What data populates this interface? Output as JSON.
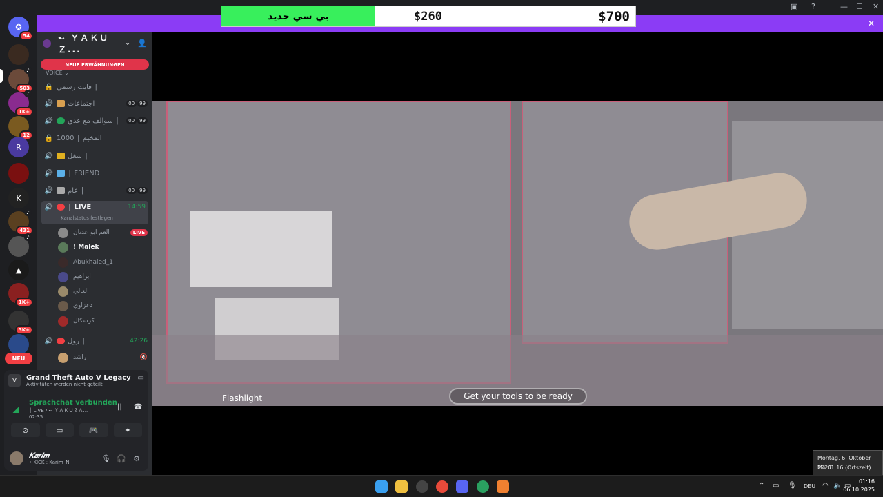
{
  "rail": {
    "badges": [
      "54",
      "503",
      "1K+",
      "12",
      "431",
      "1K+",
      "3K+"
    ],
    "neu_label": "NEU"
  },
  "sidebar": {
    "server_name": "➸ ＹＡＫＵＺ...",
    "mentions_label": "NEUE ERWÄHNUNGEN",
    "voice_category": "VOICE",
    "channels": [
      {
        "name": "فايت رسمي │",
        "count_a": "",
        "count_b": ""
      },
      {
        "name": "اجتماعات │",
        "count_a": "00",
        "count_b": "99"
      },
      {
        "name": "سوالف مع عدي │",
        "count_a": "00",
        "count_b": "99"
      },
      {
        "name": "المخيم │ 1000",
        "count_a": "",
        "count_b": ""
      },
      {
        "name": "شغل │",
        "count_a": "",
        "count_b": ""
      },
      {
        "name": "│ FRIEND",
        "count_a": "",
        "count_b": ""
      },
      {
        "name": "عام │",
        "count_a": "00",
        "count_b": "99"
      }
    ],
    "live_channel": {
      "name": "│ LIVE",
      "timer": "14:59",
      "sub": "Kanalstatus festlegen"
    },
    "members": [
      {
        "name": "العم ابو عدنان",
        "live": "LIVE"
      },
      {
        "name": "! Malek",
        "live": ""
      },
      {
        "name": "Abukhaled_1",
        "live": ""
      },
      {
        "name": "ابراهيم",
        "live": ""
      },
      {
        "name": "العالي",
        "live": ""
      },
      {
        "name": "دعزاوي",
        "live": ""
      },
      {
        "name": "كرسكال",
        "live": ""
      }
    ],
    "second_channel": {
      "name": "رول │",
      "timer": "42:26"
    },
    "second_member": {
      "name": "راشد"
    }
  },
  "panel": {
    "game_title": "Grand Theft Auto V Legacy",
    "game_sub": "Aktivitäten werden nicht geteilt",
    "voice_title": "Sprachchat verbunden",
    "voice_sub": "│ LIVE / ➸ ＹＡＫＵＺＡ...",
    "voice_time": "02:35",
    "user_name": "𝑲𝒂𝒓𝒊𝒎",
    "user_status": "• KICK : Karim_N"
  },
  "overlay": {
    "label": "بي سي جديد",
    "current": "$260",
    "goal": "$700"
  },
  "video": {
    "caption_left": "Flashlight",
    "caption_mid": "Get your tools to be ready"
  },
  "tooltip": {
    "date": "Montag, 6. Oktober 2025",
    "time": "Mo 01:16 (Ortszeit)"
  },
  "taskbar": {
    "lang": "DEU",
    "time": "01:16",
    "date": "06.10.2025"
  },
  "colors": {
    "accent_purple": "#8b3cf5",
    "discord_red": "#f23f43",
    "voice_green": "#23a559",
    "overlay_green": "#38ef5c"
  }
}
